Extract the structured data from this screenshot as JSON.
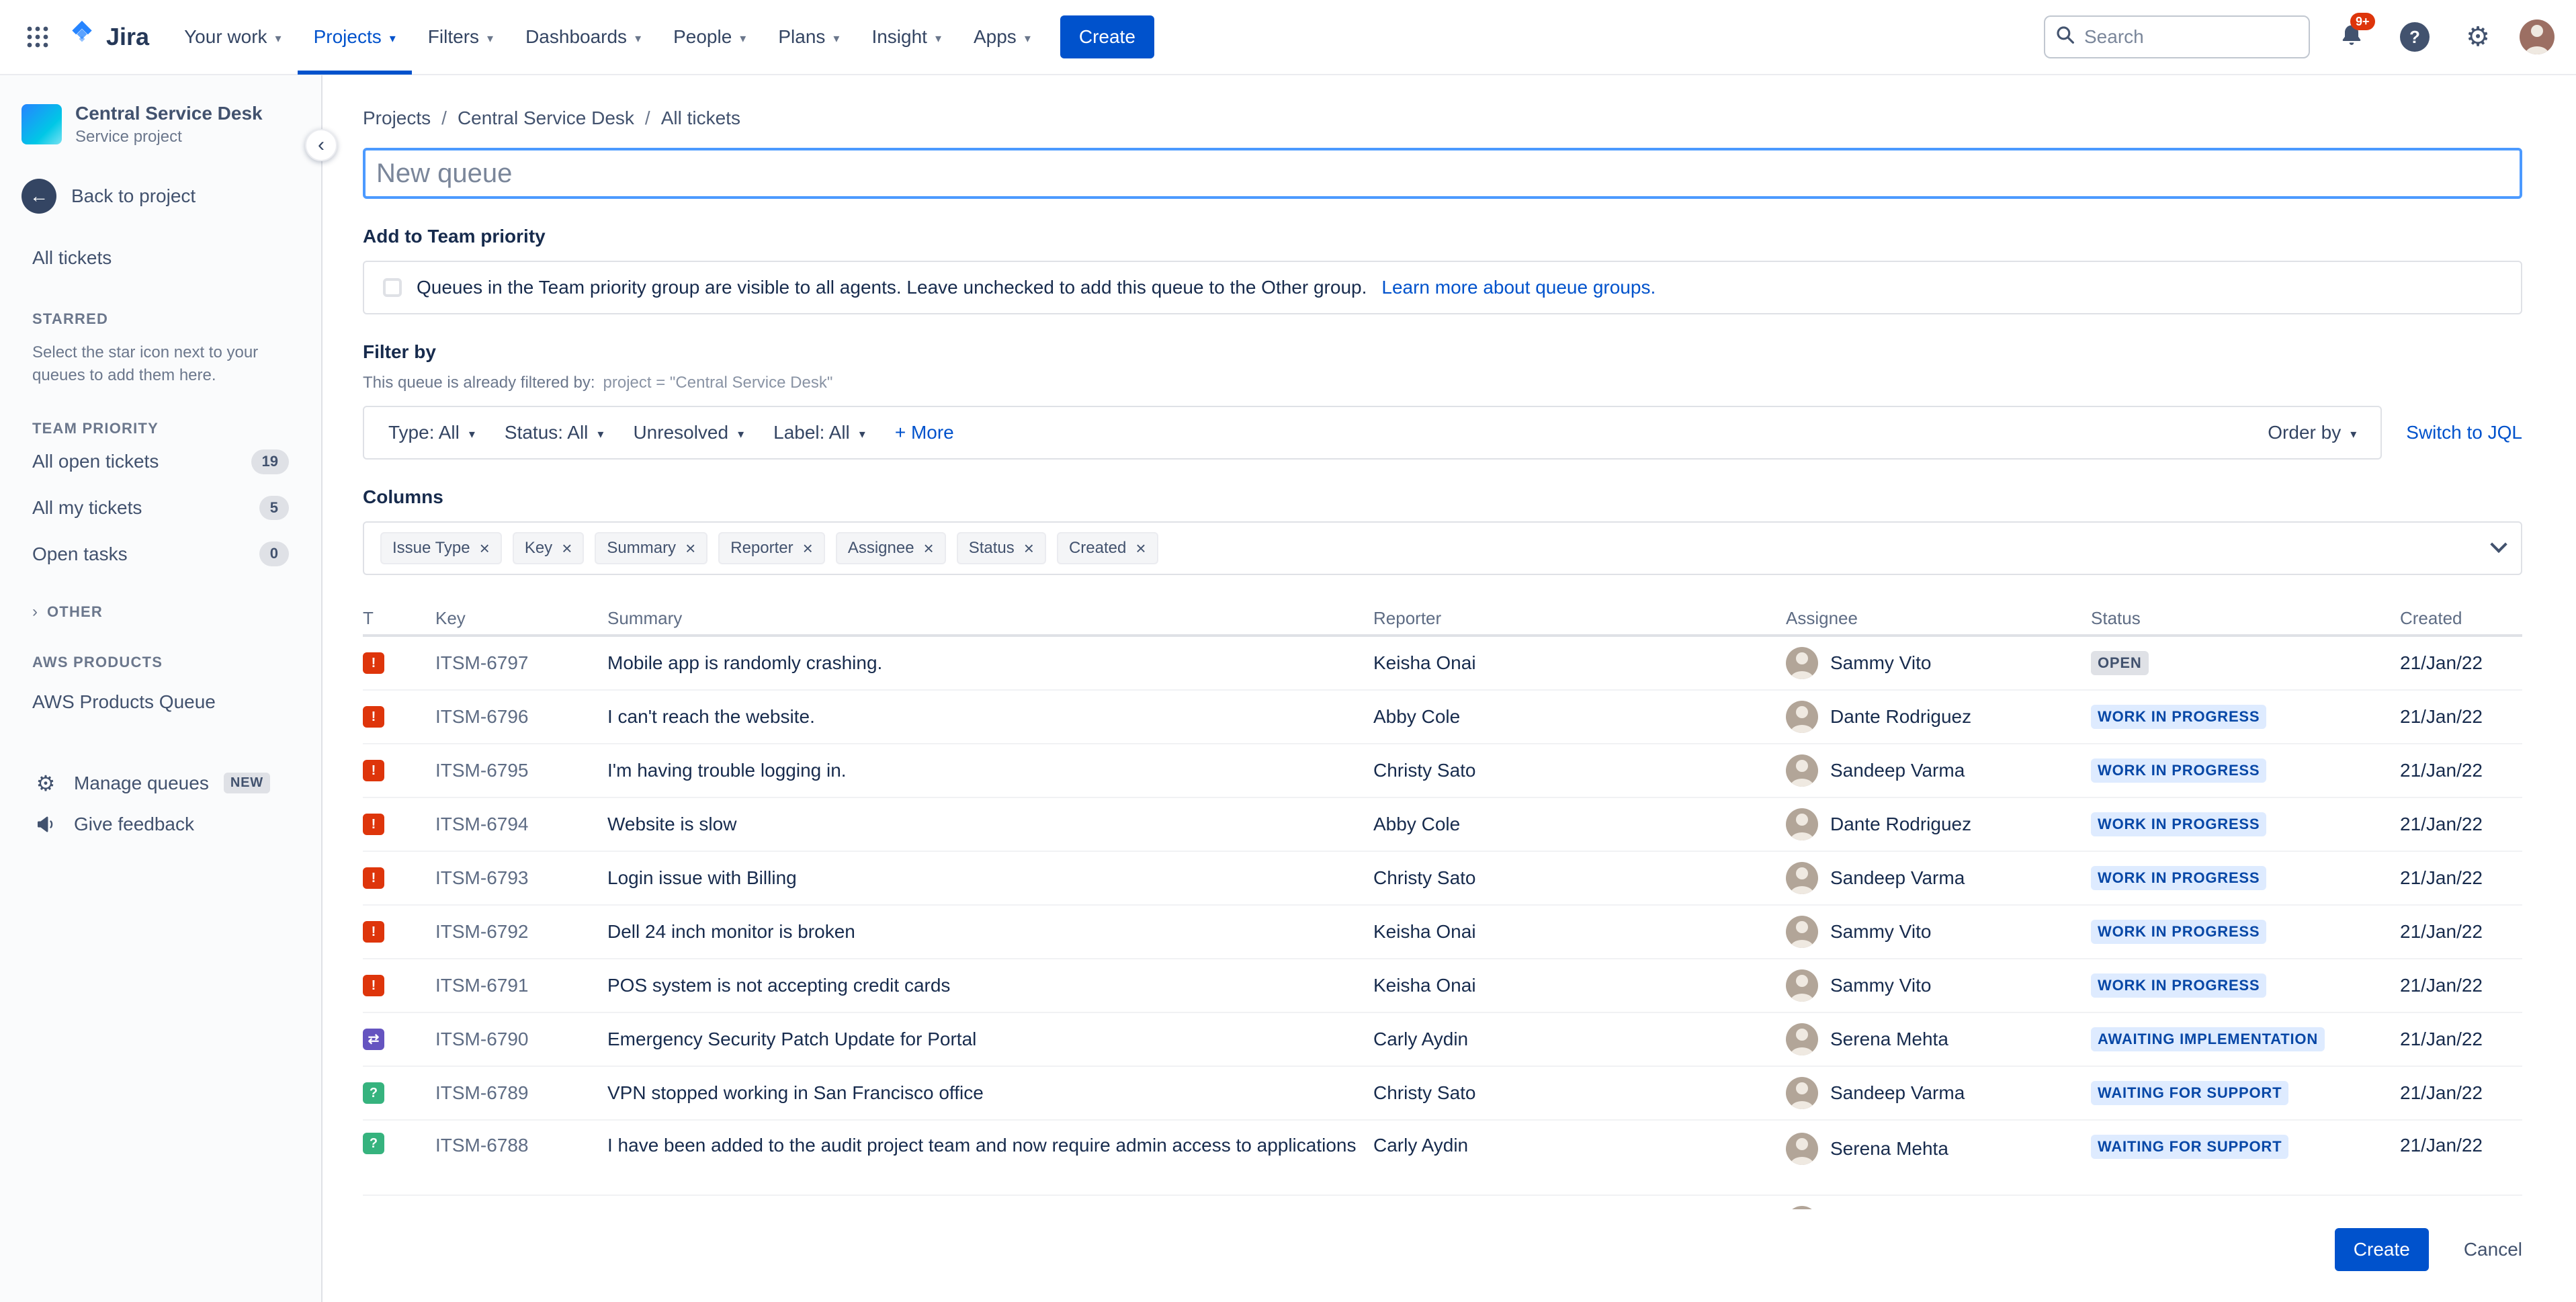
{
  "colors": {
    "primary_blue": "#0052CC",
    "focus_border": "#4C9AFF",
    "badge_blue_bg": "#DEEBFF",
    "badge_blue_text": "#0747A6",
    "badge_gray_bg": "#DFE1E6",
    "badge_gray_text": "#42526E",
    "notification_red": "#DE350B"
  },
  "nav": {
    "logo_text": "Jira",
    "items": [
      "Your work",
      "Projects",
      "Filters",
      "Dashboards",
      "People",
      "Plans",
      "Insight",
      "Apps"
    ],
    "active_item": "Projects",
    "create_label": "Create",
    "search_placeholder": "Search",
    "notification_count": "9+",
    "help_glyph": "?"
  },
  "sidebar": {
    "project_name": "Central Service Desk",
    "project_type": "Service project",
    "back_label": "Back to project",
    "all_tickets_label": "All tickets",
    "starred_header": "STARRED",
    "starred_hint": "Select the star icon next to your queues to add them here.",
    "team_priority_header": "TEAM PRIORITY",
    "team_priority_items": [
      {
        "label": "All open tickets",
        "count": "19"
      },
      {
        "label": "All my tickets",
        "count": "5"
      },
      {
        "label": "Open tasks",
        "count": "0"
      }
    ],
    "other_header": "OTHER",
    "aws_header": "AWS PRODUCTS",
    "aws_item": "AWS Products Queue",
    "manage_queues_label": "Manage queues",
    "manage_queues_badge": "NEW",
    "give_feedback_label": "Give feedback"
  },
  "breadcrumb": [
    "Projects",
    "Central Service Desk",
    "All tickets"
  ],
  "queue_form": {
    "name_placeholder": "New queue",
    "team_priority_heading": "Add to Team priority",
    "team_priority_text": "Queues in the Team priority group are visible to all agents. Leave unchecked to add this queue to the Other group.",
    "team_priority_link": "Learn more about queue groups.",
    "filter_heading": "Filter by",
    "filter_note": "This queue is already filtered by:",
    "filter_code": "project = \"Central Service Desk\"",
    "filters": [
      "Type: All",
      "Status: All",
      "Unresolved",
      "Label: All"
    ],
    "more_label": "+ More",
    "order_by_label": "Order by",
    "switch_jql_label": "Switch to JQL",
    "columns_heading": "Columns",
    "column_chips": [
      "Issue Type",
      "Key",
      "Summary",
      "Reporter",
      "Assignee",
      "Status",
      "Created"
    ],
    "create_label": "Create",
    "cancel_label": "Cancel"
  },
  "issue_types": {
    "incident": {
      "color": "#DE350B",
      "glyph": "!"
    },
    "change": {
      "color": "#6554C0",
      "glyph": "⇄"
    },
    "service_request": {
      "color": "#36B37E",
      "glyph": "?"
    }
  },
  "table": {
    "headers": [
      "T",
      "Key",
      "Summary",
      "Reporter",
      "Assignee",
      "Status",
      "Created"
    ],
    "rows": [
      {
        "type": "incident",
        "key": "ITSM-6797",
        "summary": "Mobile app is randomly crashing.",
        "reporter": "Keisha Onai",
        "assignee": "Sammy Vito",
        "status": "OPEN",
        "status_style": "gray",
        "created": "21/Jan/22"
      },
      {
        "type": "incident",
        "key": "ITSM-6796",
        "summary": "I can't reach the website.",
        "reporter": "Abby Cole",
        "assignee": "Dante Rodriguez",
        "status": "WORK IN PROGRESS",
        "status_style": "blue",
        "created": "21/Jan/22"
      },
      {
        "type": "incident",
        "key": "ITSM-6795",
        "summary": "I'm having trouble logging in.",
        "reporter": "Christy Sato",
        "assignee": "Sandeep Varma",
        "status": "WORK IN PROGRESS",
        "status_style": "blue",
        "created": "21/Jan/22"
      },
      {
        "type": "incident",
        "key": "ITSM-6794",
        "summary": "Website is slow",
        "reporter": "Abby Cole",
        "assignee": "Dante Rodriguez",
        "status": "WORK IN PROGRESS",
        "status_style": "blue",
        "created": "21/Jan/22"
      },
      {
        "type": "incident",
        "key": "ITSM-6793",
        "summary": "Login issue with Billing",
        "reporter": "Christy Sato",
        "assignee": "Sandeep Varma",
        "status": "WORK IN PROGRESS",
        "status_style": "blue",
        "created": "21/Jan/22"
      },
      {
        "type": "incident",
        "key": "ITSM-6792",
        "summary": "Dell 24 inch monitor is broken",
        "reporter": "Keisha Onai",
        "assignee": "Sammy Vito",
        "status": "WORK IN PROGRESS",
        "status_style": "blue",
        "created": "21/Jan/22"
      },
      {
        "type": "incident",
        "key": "ITSM-6791",
        "summary": "POS system is not accepting credit cards",
        "reporter": "Keisha Onai",
        "assignee": "Sammy Vito",
        "status": "WORK IN PROGRESS",
        "status_style": "blue",
        "created": "21/Jan/22"
      },
      {
        "type": "change",
        "key": "ITSM-6790",
        "summary": "Emergency Security Patch Update for Portal",
        "reporter": "Carly Aydin",
        "assignee": "Serena Mehta",
        "status": "AWAITING IMPLEMENTATION",
        "status_style": "blue",
        "created": "21/Jan/22"
      },
      {
        "type": "service_request",
        "key": "ITSM-6789",
        "summary": "VPN stopped working in San Francisco office",
        "reporter": "Christy Sato",
        "assignee": "Sandeep Varma",
        "status": "WAITING FOR SUPPORT",
        "status_style": "blue",
        "created": "21/Jan/22"
      },
      {
        "type": "service_request",
        "key": "ITSM-6788",
        "summary": "I have been added to the audit project team and now require admin access to applications",
        "reporter": "Carly Aydin",
        "assignee": "Serena Mehta",
        "status": "WAITING FOR SUPPORT",
        "status_style": "blue",
        "created": "21/Jan/22"
      }
    ],
    "partial_row": {
      "type": "service_request"
    }
  }
}
